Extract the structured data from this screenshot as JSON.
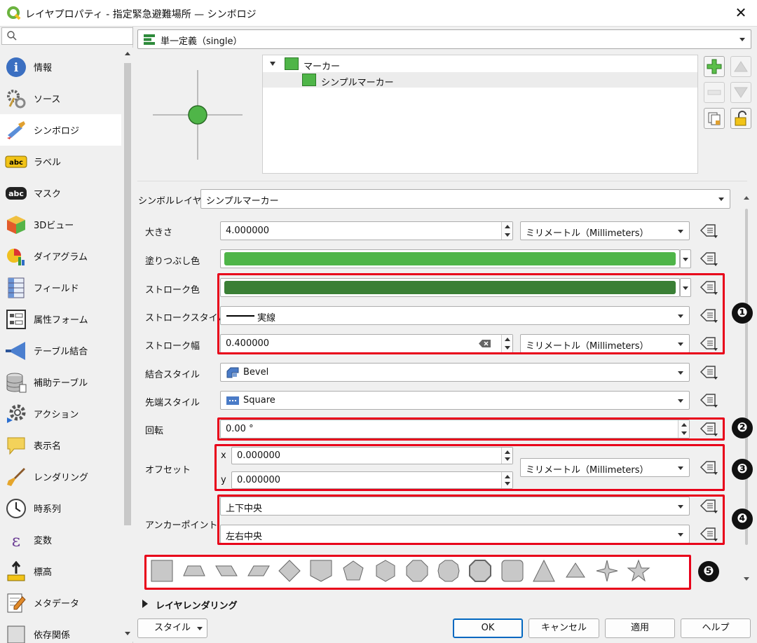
{
  "window": {
    "title": "レイヤプロパティ - 指定緊急避難場所 — シンボロジ",
    "close": "✕"
  },
  "sidebar": {
    "search_placeholder": "",
    "items": [
      {
        "label": "情報",
        "icon": "info-icon"
      },
      {
        "label": "ソース",
        "icon": "source-icon"
      },
      {
        "label": "シンボロジ",
        "icon": "symbology-icon",
        "selected": true
      },
      {
        "label": "ラベル",
        "icon": "labels-icon"
      },
      {
        "label": "マスク",
        "icon": "mask-icon"
      },
      {
        "label": "3Dビュー",
        "icon": "3d-view-icon"
      },
      {
        "label": "ダイアグラム",
        "icon": "diagram-icon"
      },
      {
        "label": "フィールド",
        "icon": "fields-icon"
      },
      {
        "label": "属性フォーム",
        "icon": "attributes-form-icon"
      },
      {
        "label": "テーブル結合",
        "icon": "joins-icon"
      },
      {
        "label": "補助テーブル",
        "icon": "auxiliary-storage-icon"
      },
      {
        "label": "アクション",
        "icon": "actions-icon"
      },
      {
        "label": "表示名",
        "icon": "display-icon"
      },
      {
        "label": "レンダリング",
        "icon": "rendering-icon"
      },
      {
        "label": "時系列",
        "icon": "temporal-icon"
      },
      {
        "label": "変数",
        "icon": "variables-icon"
      },
      {
        "label": "標高",
        "icon": "elevation-icon"
      },
      {
        "label": "メタデータ",
        "icon": "metadata-icon"
      },
      {
        "label": "依存関係",
        "icon": "dependencies-icon"
      }
    ]
  },
  "renderer": {
    "label": "単一定義（single）"
  },
  "symbol_tree": {
    "root": "マーカー",
    "child": "シンプルマーカー"
  },
  "symbol_layer_type": {
    "label": "シンボルレイヤ型",
    "value": "シンプルマーカー"
  },
  "properties": {
    "size": {
      "label": "大きさ",
      "value": "4.000000",
      "unit": "ミリメートル（Millimeters）"
    },
    "fill_color": {
      "label": "塗りつぶし色",
      "color": "#4fb548"
    },
    "stroke_color": {
      "label": "ストローク色",
      "color": "#3a7f35"
    },
    "stroke_style": {
      "label": "ストロークスタイル",
      "value": "実線"
    },
    "stroke_width": {
      "label": "ストローク幅",
      "value": "0.400000",
      "unit": "ミリメートル（Millimeters）"
    },
    "join_style": {
      "label": "結合スタイル",
      "value": "Bevel"
    },
    "cap_style": {
      "label": "先端スタイル",
      "value": "Square"
    },
    "rotation": {
      "label": "回転",
      "value": "0.00 °"
    },
    "offset": {
      "label": "オフセット",
      "x_label": "x",
      "x": "0.000000",
      "y_label": "y",
      "y": "0.000000",
      "unit": "ミリメートル（Millimeters）"
    },
    "anchor": {
      "label": "アンカーポイント",
      "vertical": "上下中央",
      "horizontal": "左右中央"
    }
  },
  "badges": [
    "❶",
    "❷",
    "❸",
    "❹",
    "❺"
  ],
  "shapes": [
    "square",
    "trapezoid",
    "parallelogram-left",
    "parallelogram-right",
    "diamond",
    "shield",
    "pentagon",
    "hexagon",
    "octagon",
    "decagon",
    "rounded-octagon",
    "rounded-square",
    "triangle",
    "equilateral-triangle",
    "star-4",
    "star-5"
  ],
  "layer_rendering": {
    "label": "レイヤレンダリング"
  },
  "buttons": {
    "style": "スタイル",
    "ok": "OK",
    "cancel": "キャンセル",
    "apply": "適用",
    "help": "ヘルプ"
  },
  "colors": {
    "accent": "#0067c0",
    "highlight": "#e8001a",
    "symbol_green": "#4fb548"
  }
}
